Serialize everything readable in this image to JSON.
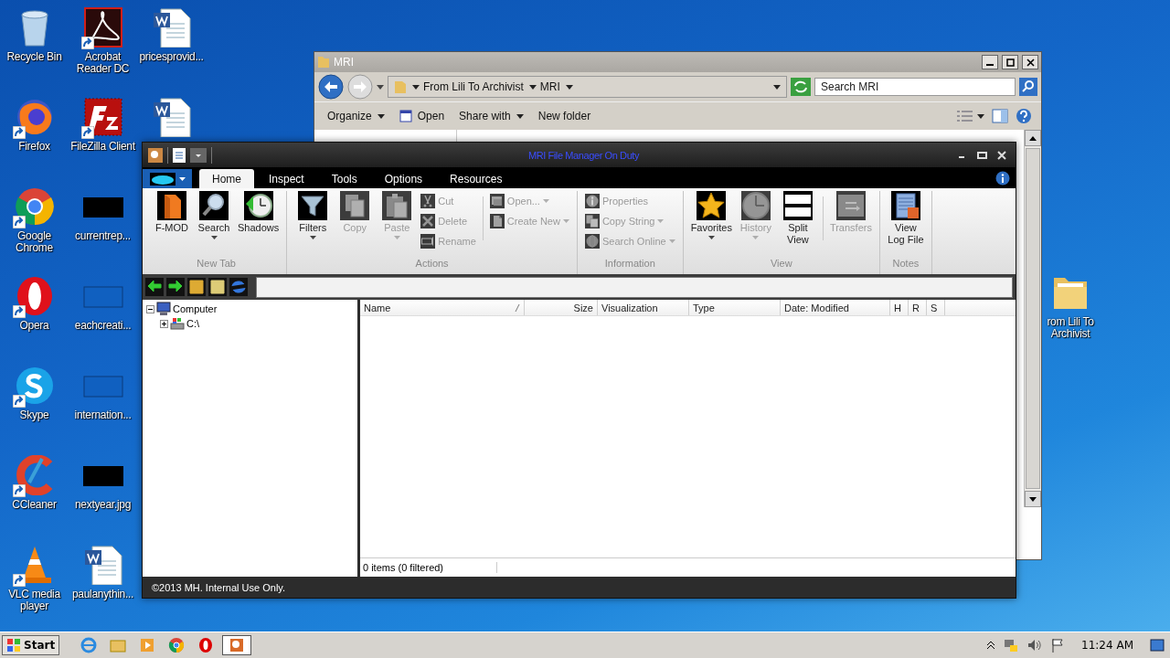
{
  "desktop": {
    "icons": [
      {
        "kind": "recycle-bin",
        "label": "Recycle Bin",
        "shortcut": false
      },
      {
        "kind": "firefox",
        "label": "Firefox",
        "shortcut": true
      },
      {
        "kind": "chrome",
        "label": "Google Chrome",
        "shortcut": true
      },
      {
        "kind": "opera",
        "label": "Opera",
        "shortcut": true
      },
      {
        "kind": "skype",
        "label": "Skype",
        "shortcut": true
      },
      {
        "kind": "ccleaner",
        "label": "CCleaner",
        "shortcut": true
      },
      {
        "kind": "vlc",
        "label": "VLC media player",
        "shortcut": true
      },
      {
        "kind": "pdf",
        "label": "Acrobat Reader DC",
        "shortcut": true
      },
      {
        "kind": "filezilla",
        "label": "FileZilla Client",
        "shortcut": true
      },
      {
        "kind": "thumb-dark",
        "label": "currentrep...",
        "shortcut": false
      },
      {
        "kind": "thumb-light",
        "label": "eachcreati...",
        "shortcut": false
      },
      {
        "kind": "thumb-light",
        "label": "internation...",
        "shortcut": false
      },
      {
        "kind": "thumb-dark",
        "label": "nextyear.jpg",
        "shortcut": false
      },
      {
        "kind": "word",
        "label": "paulanythin...",
        "shortcut": false
      },
      {
        "kind": "word",
        "label": "pricesprovid...",
        "shortcut": false
      },
      {
        "kind": "word",
        "shortcut": false
      }
    ],
    "side_folder": {
      "kind": "folder",
      "label": "rom Lili To Archivist",
      "shortcut": false
    }
  },
  "explorer_window": {
    "title": "MRI",
    "breadcrumb": [
      "From Lili To Archivist",
      "MRI"
    ],
    "search": {
      "placeholder": "Search MRI"
    },
    "toolbar": [
      {
        "kind": "menu",
        "label": "Organize"
      },
      {
        "kind": "icon-button",
        "label": "Open"
      },
      {
        "kind": "menu",
        "label": "Share with"
      },
      {
        "kind": "button",
        "label": "New folder"
      }
    ]
  },
  "mri_window": {
    "title": "MRI File Manager On Duty",
    "tabs": [
      {
        "label": "Home",
        "selected": true
      },
      {
        "label": "Inspect",
        "selected": false
      },
      {
        "label": "Tools",
        "selected": false
      },
      {
        "label": "Options",
        "selected": false
      },
      {
        "label": "Resources",
        "selected": false
      }
    ],
    "ribbon": [
      {
        "label": "New Tab",
        "buttons": [
          {
            "kind": "large",
            "label": "F-MOD",
            "disabled": false,
            "dropdown": false
          },
          {
            "kind": "large",
            "label": "Search",
            "disabled": false,
            "dropdown": true
          },
          {
            "kind": "large",
            "label": "Shadows",
            "disabled": false,
            "dropdown": false
          }
        ]
      },
      {
        "label": "Actions",
        "buttons": [
          {
            "kind": "large",
            "label": "Filters",
            "disabled": false,
            "dropdown": true
          },
          {
            "kind": "large",
            "label": "Copy",
            "disabled": true,
            "dropdown": false
          },
          {
            "kind": "large",
            "label": "Paste",
            "disabled": true,
            "dropdown": true
          },
          {
            "kind": "small",
            "label": "Cut",
            "disabled": true,
            "dropdown": false
          },
          {
            "kind": "small",
            "label": "Delete",
            "disabled": true,
            "dropdown": false
          },
          {
            "kind": "small",
            "label": "Rename",
            "disabled": true,
            "dropdown": false
          },
          {
            "kind": "separator"
          },
          {
            "kind": "small",
            "label": "Open...",
            "disabled": true,
            "dropdown": true
          },
          {
            "kind": "small",
            "label": "Create New",
            "disabled": true,
            "dropdown": true
          }
        ]
      },
      {
        "label": "Information",
        "buttons": [
          {
            "kind": "small",
            "label": "Properties",
            "disabled": true,
            "dropdown": false
          },
          {
            "kind": "small",
            "label": "Copy String",
            "disabled": true,
            "dropdown": true
          },
          {
            "kind": "small",
            "label": "Search Online",
            "disabled": true,
            "dropdown": true
          }
        ]
      },
      {
        "label": "View",
        "buttons": [
          {
            "kind": "large",
            "label": "Favorites",
            "disabled": false,
            "dropdown": true
          },
          {
            "kind": "large",
            "label": "History",
            "disabled": true,
            "dropdown": true
          },
          {
            "kind": "large",
            "label": "Split View",
            "disabled": false,
            "dropdown": false
          },
          {
            "kind": "separator"
          },
          {
            "kind": "large",
            "label": "Transfers",
            "disabled": true,
            "dropdown": false
          }
        ]
      },
      {
        "label": "Notes",
        "buttons": [
          {
            "kind": "large",
            "label": "View Log File",
            "disabled": false,
            "dropdown": false
          }
        ]
      }
    ],
    "tree": [
      {
        "label": "Computer",
        "expanded": true,
        "children": [
          {
            "label": "C:\\",
            "expanded": false
          }
        ]
      }
    ],
    "columns": [
      "Name",
      "Size",
      "Visualization",
      "Type",
      "Date: Modified",
      "H",
      "R",
      "S"
    ],
    "status": "0 items (0 filtered)",
    "footer": "©2013 MH. Internal Use Only."
  },
  "taskbar": {
    "start": "Start",
    "clock": "11:24 AM"
  }
}
